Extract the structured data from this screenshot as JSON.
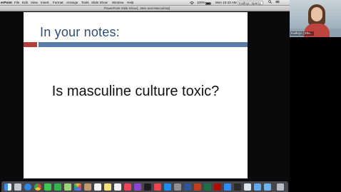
{
  "menubar": {
    "items": [
      "erPoint",
      "File",
      "Edit",
      "View",
      "Insert",
      "Format",
      "Arrange",
      "Tools",
      "Slide Show",
      "Window",
      "Help"
    ],
    "battery": "100%",
    "datetime": "Mon 10:43 AM",
    "user": "Kathryn Sperry"
  },
  "ppt_window": {
    "tab_title": "PowerPoint Slide Show",
    "doc_title": "[...Men and Masculinity]"
  },
  "slide": {
    "title": "In your notes:",
    "body": "Is masculine culture toxic?",
    "colors": {
      "title": "#2f4e78",
      "rule_red": "#b2403a",
      "rule_blue": "#5b7bab"
    }
  },
  "dock": {
    "icons": [
      "finder-icon",
      "launchpad-icon",
      "safari-icon",
      "chrome-icon",
      "messages-icon",
      "facetime-icon",
      "maps-icon",
      "photos-icon",
      "contacts-icon",
      "calendar-icon",
      "notes-icon",
      "reminders-icon",
      "music-icon",
      "podcasts-icon",
      "tv-icon",
      "news-icon",
      "app-store-icon",
      "system-preferences-icon",
      "word-icon",
      "powerpoint-icon",
      "excel-icon",
      "acrobat-icon",
      "zoom-icon",
      "terminal-icon",
      "preview-icon",
      "folder-icon",
      "downloads-icon",
      "trash-icon"
    ]
  },
  "participant": {
    "name": "Kathryn (She..."
  }
}
